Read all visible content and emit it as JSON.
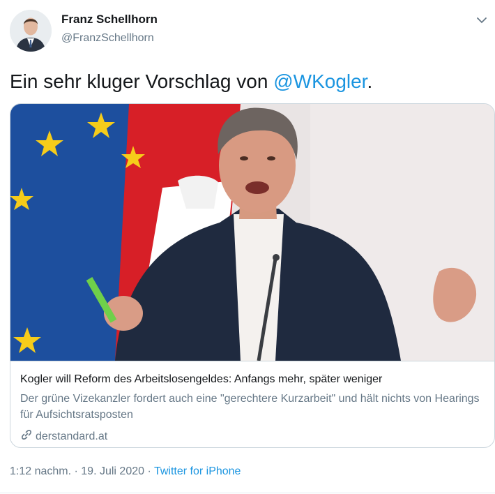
{
  "author": {
    "name": "Franz Schellhorn",
    "handle": "@FranzSchellhorn"
  },
  "tweet": {
    "text_before": "Ein sehr kluger Vorschlag von ",
    "mention": "@WKogler",
    "text_after": "."
  },
  "card": {
    "title": "Kogler will Reform des Arbeitslosengeldes: Anfangs mehr, später weniger",
    "description": "Der grüne Vizekanzler fordert auch eine \"gerechtere Kurzarbeit\" und hält nichts von Hearings für Aufsichtsratsposten",
    "domain": "derstandard.at",
    "image_description": "Photo of politician speaking in front of EU and Austrian flags"
  },
  "meta": {
    "time": "1:12 nachm.",
    "separator": " · ",
    "date": "19. Juli 2020",
    "source": "Twitter for iPhone"
  },
  "colors": {
    "link": "#1b95e0",
    "secondary": "#657786",
    "border": "#ccd6dd"
  }
}
